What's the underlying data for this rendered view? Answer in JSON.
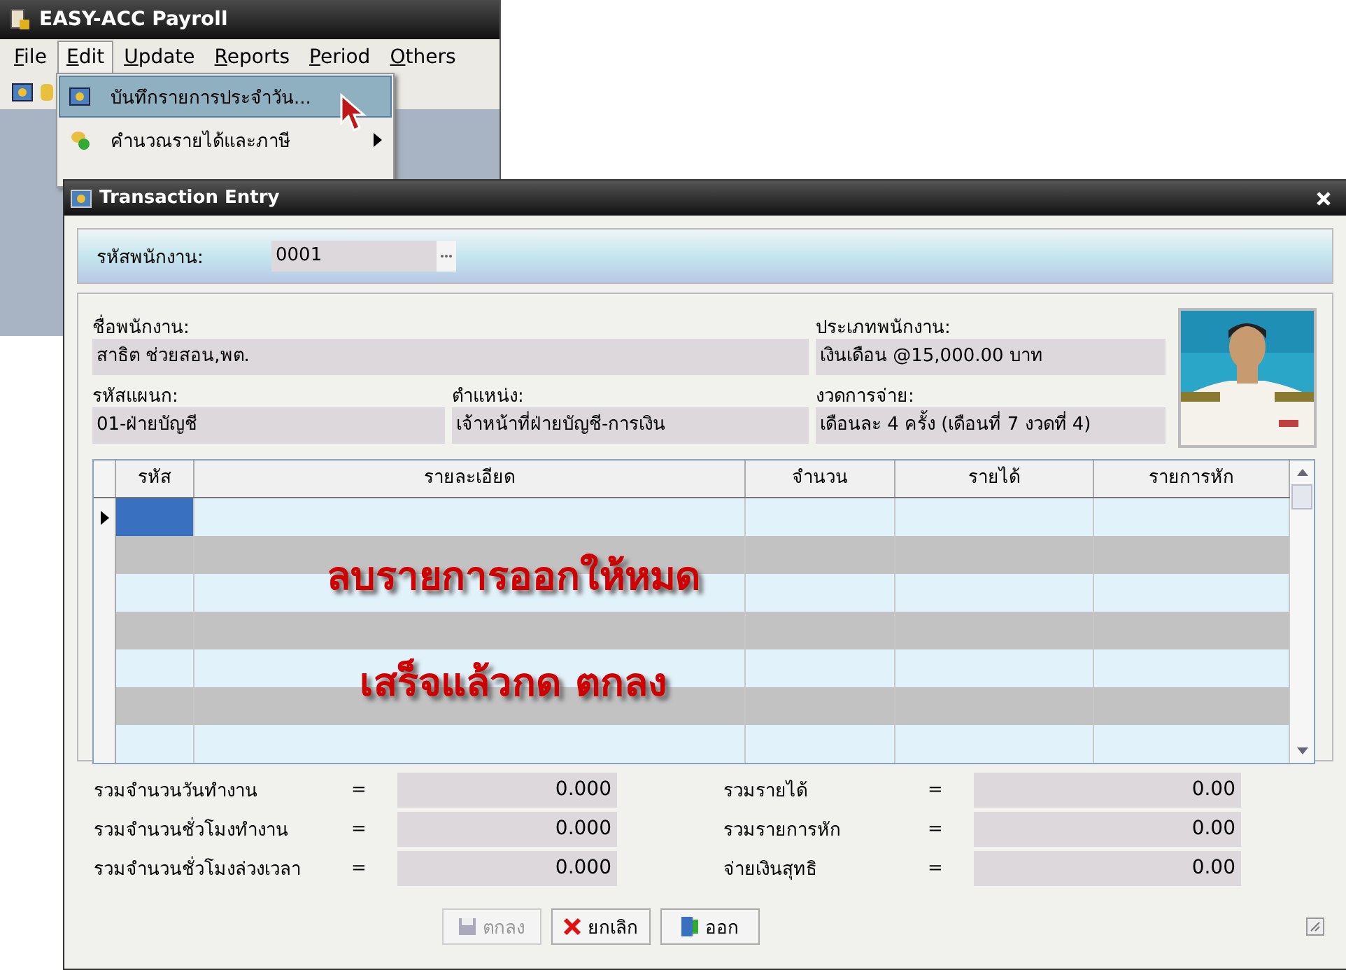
{
  "main_window": {
    "title": "EASY-ACC Payroll",
    "menu": [
      {
        "label": "File",
        "selected": false
      },
      {
        "label": "Edit",
        "selected": true
      },
      {
        "label": "Update",
        "selected": false
      },
      {
        "label": "Reports",
        "selected": false
      },
      {
        "label": "Period",
        "selected": false
      },
      {
        "label": "Others",
        "selected": false
      }
    ],
    "dropdown": [
      {
        "label": "บันทึกรายการประจำวัน...",
        "selected": true,
        "submenu": false
      },
      {
        "label": "คำนวณรายได้และภาษี",
        "selected": false,
        "submenu": true
      }
    ]
  },
  "dialog": {
    "title": "Transaction Entry",
    "employee_code": {
      "label": "รหัสพนักงาน:",
      "value": "0001"
    },
    "fields": [
      {
        "label": "ชื่อพนักงาน:",
        "value": "สาธิต  ช่วยสอน,พต."
      },
      {
        "label": "ประเภทพนักงาน:",
        "value": "เงินเดือน @15,000.00 บาท"
      },
      {
        "label": "รหัสแผนก:",
        "value": "01-ฝ่ายบัญชี"
      },
      {
        "label": "ตำแหน่ง:",
        "value": "เจ้าหน้าที่ฝ่ายบัญชี-การเงิน"
      },
      {
        "label": "งวดการจ่าย:",
        "value": "เดือนละ 4 ครั้ง (เดือนที่ 7 งวดที่ 4)"
      }
    ],
    "photo": {
      "kind": "picture"
    },
    "table": {
      "columns": [
        "รหัส",
        "รายละเอียด",
        "จำนวน",
        "รายได้",
        "รายการหัก"
      ],
      "rows": [
        {
          "selected": true
        },
        {
          "selected": false
        },
        {
          "selected": false
        },
        {
          "selected": false
        },
        {
          "selected": false
        },
        {
          "selected": false
        },
        {
          "selected": false
        }
      ]
    },
    "annotation": [
      "ลบรายการออกให้หมด",
      "เสร็จแล้วกด ตกลง"
    ],
    "totals": [
      {
        "label": "รวมจำนวนวันทำงาน",
        "sign": "=",
        "value": "0.000"
      },
      {
        "label": "รวมรายได้",
        "sign": "=",
        "value": "0.00"
      },
      {
        "label": "รวมจำนวนชั่วโมงทำงาน",
        "sign": "=",
        "value": "0.000"
      },
      {
        "label": "รวมรายการหัก",
        "sign": "=",
        "value": "0.00"
      },
      {
        "label": "รวมจำนวนชั่วโมงล่วงเวลา",
        "sign": "=",
        "value": "0.000"
      },
      {
        "label": "จ่ายเงินสุทธิ",
        "sign": "=",
        "value": "0.00"
      }
    ],
    "buttons": [
      {
        "label": "ตกลง",
        "kind": "save",
        "disabled": true
      },
      {
        "label": "ยกเลิก",
        "kind": "cancel",
        "disabled": false
      },
      {
        "label": "ออก",
        "kind": "exit",
        "disabled": false
      }
    ]
  }
}
